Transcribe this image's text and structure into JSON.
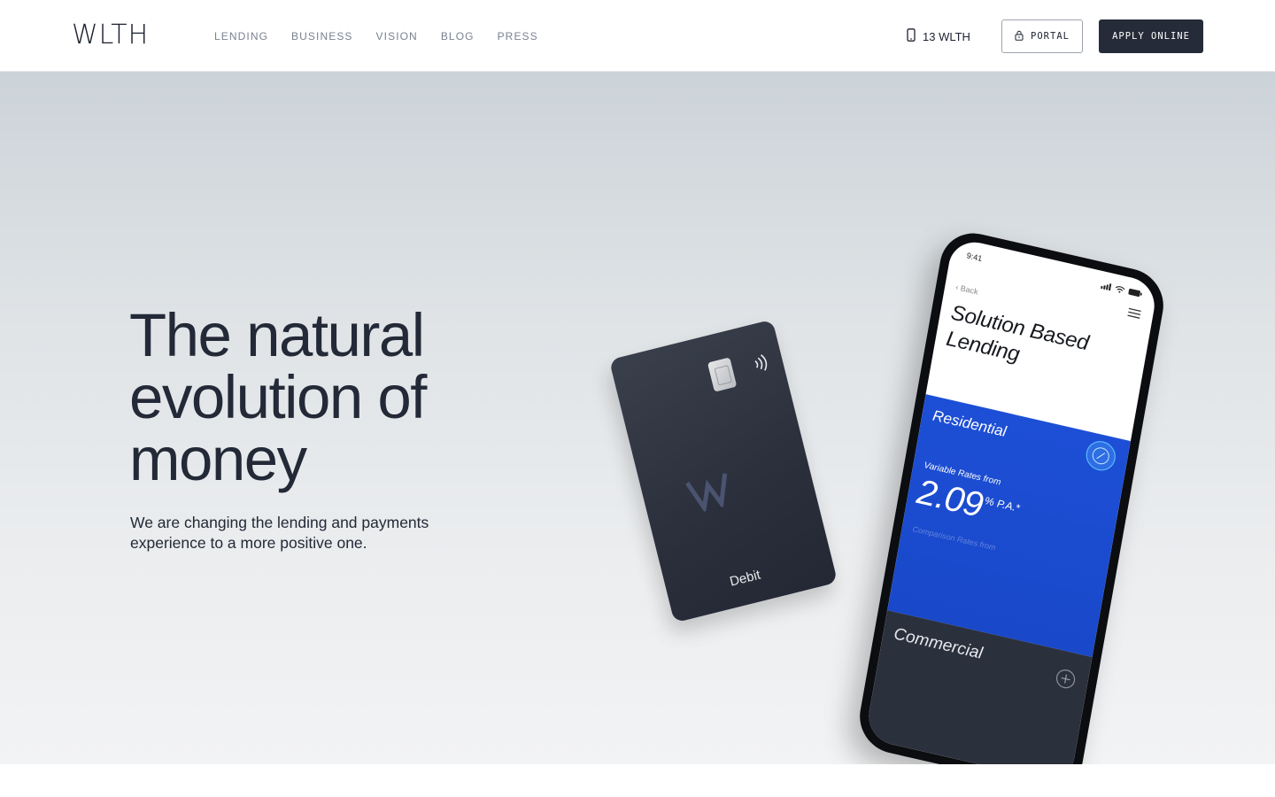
{
  "header": {
    "logo": "WLTH",
    "nav": [
      "LENDING",
      "BUSINESS",
      "VISION",
      "BLOG",
      "PRESS"
    ],
    "phone_label": "13 WLTH",
    "portal_label": "PORTAL",
    "apply_label": "APPLY ONLINE"
  },
  "hero": {
    "headline_lines": [
      "The natural",
      "evolution of",
      "money"
    ],
    "subhead_lines": [
      "We are changing the lending and payments",
      "experience to a more positive one."
    ]
  },
  "card": {
    "label": "Debit"
  },
  "phone_app": {
    "time": "9:41",
    "back_label": "Back",
    "title_lines": [
      "Solution Based",
      "Lending"
    ],
    "residential_label": "Residential",
    "variable_rates_label": "Variable Rates from",
    "rate_value": "2.09",
    "rate_unit": "% P.A.*",
    "comparison_label": "Comparison Rates from",
    "commercial_label": "Commercial"
  },
  "colors": {
    "primary_dark": "#252b38",
    "accent_blue": "#1d4fd6",
    "nav_grey": "#7a8190"
  }
}
